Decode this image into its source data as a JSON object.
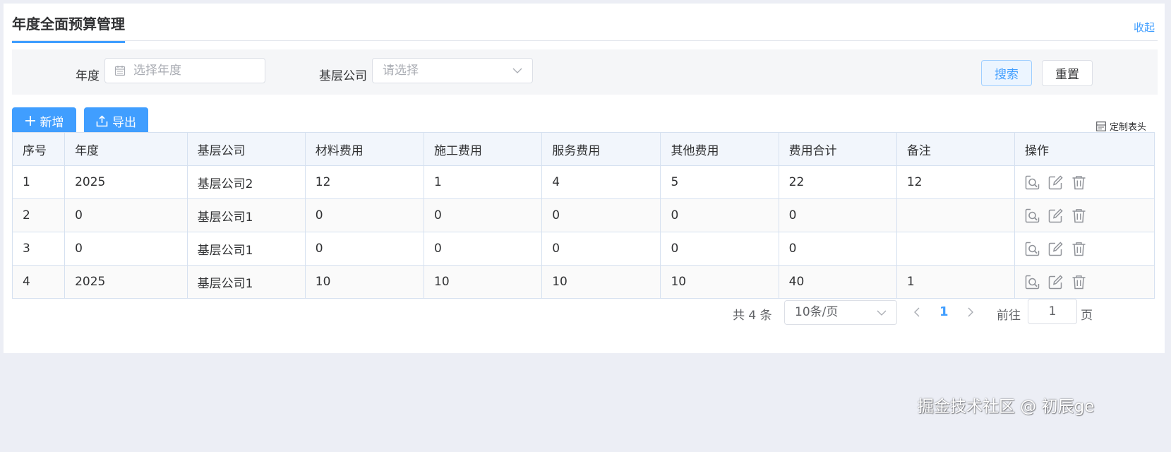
{
  "page": {
    "title": "年度全面预算管理",
    "collapse_label": "收起"
  },
  "filters": {
    "year_label": "年度",
    "year_placeholder": "选择年度",
    "company_label": "基层公司",
    "company_placeholder": "请选择",
    "search_label": "搜索",
    "reset_label": "重置"
  },
  "toolbar": {
    "add_label": "新增",
    "export_label": "导出",
    "custom_header_label": "定制表头"
  },
  "table": {
    "columns": [
      "序号",
      "年度",
      "基层公司",
      "材料费用",
      "施工费用",
      "服务费用",
      "其他费用",
      "费用合计",
      "备注",
      "操作"
    ],
    "rows": [
      [
        "1",
        "2025",
        "基层公司2",
        "12",
        "1",
        "4",
        "5",
        "22",
        "12"
      ],
      [
        "2",
        "0",
        "基层公司1",
        "0",
        "0",
        "0",
        "0",
        "0",
        ""
      ],
      [
        "3",
        "0",
        "基层公司1",
        "0",
        "0",
        "0",
        "0",
        "0",
        ""
      ],
      [
        "4",
        "2025",
        "基层公司1",
        "10",
        "10",
        "10",
        "10",
        "40",
        "1"
      ]
    ],
    "row_actions": [
      "view-icon",
      "edit-icon",
      "delete-icon"
    ]
  },
  "pagination": {
    "total_text": "共 4 条",
    "page_size": "10条/页",
    "current_page": "1",
    "goto_label": "前往",
    "goto_value": "1",
    "page_suffix": "页"
  },
  "watermark": "掘金技术社区 @ 初辰ge",
  "colors": {
    "accent": "#409eff",
    "header_bg": "#f2f6fc",
    "filter_bg": "#f5f6f8",
    "page_bg": "#eceef5"
  }
}
